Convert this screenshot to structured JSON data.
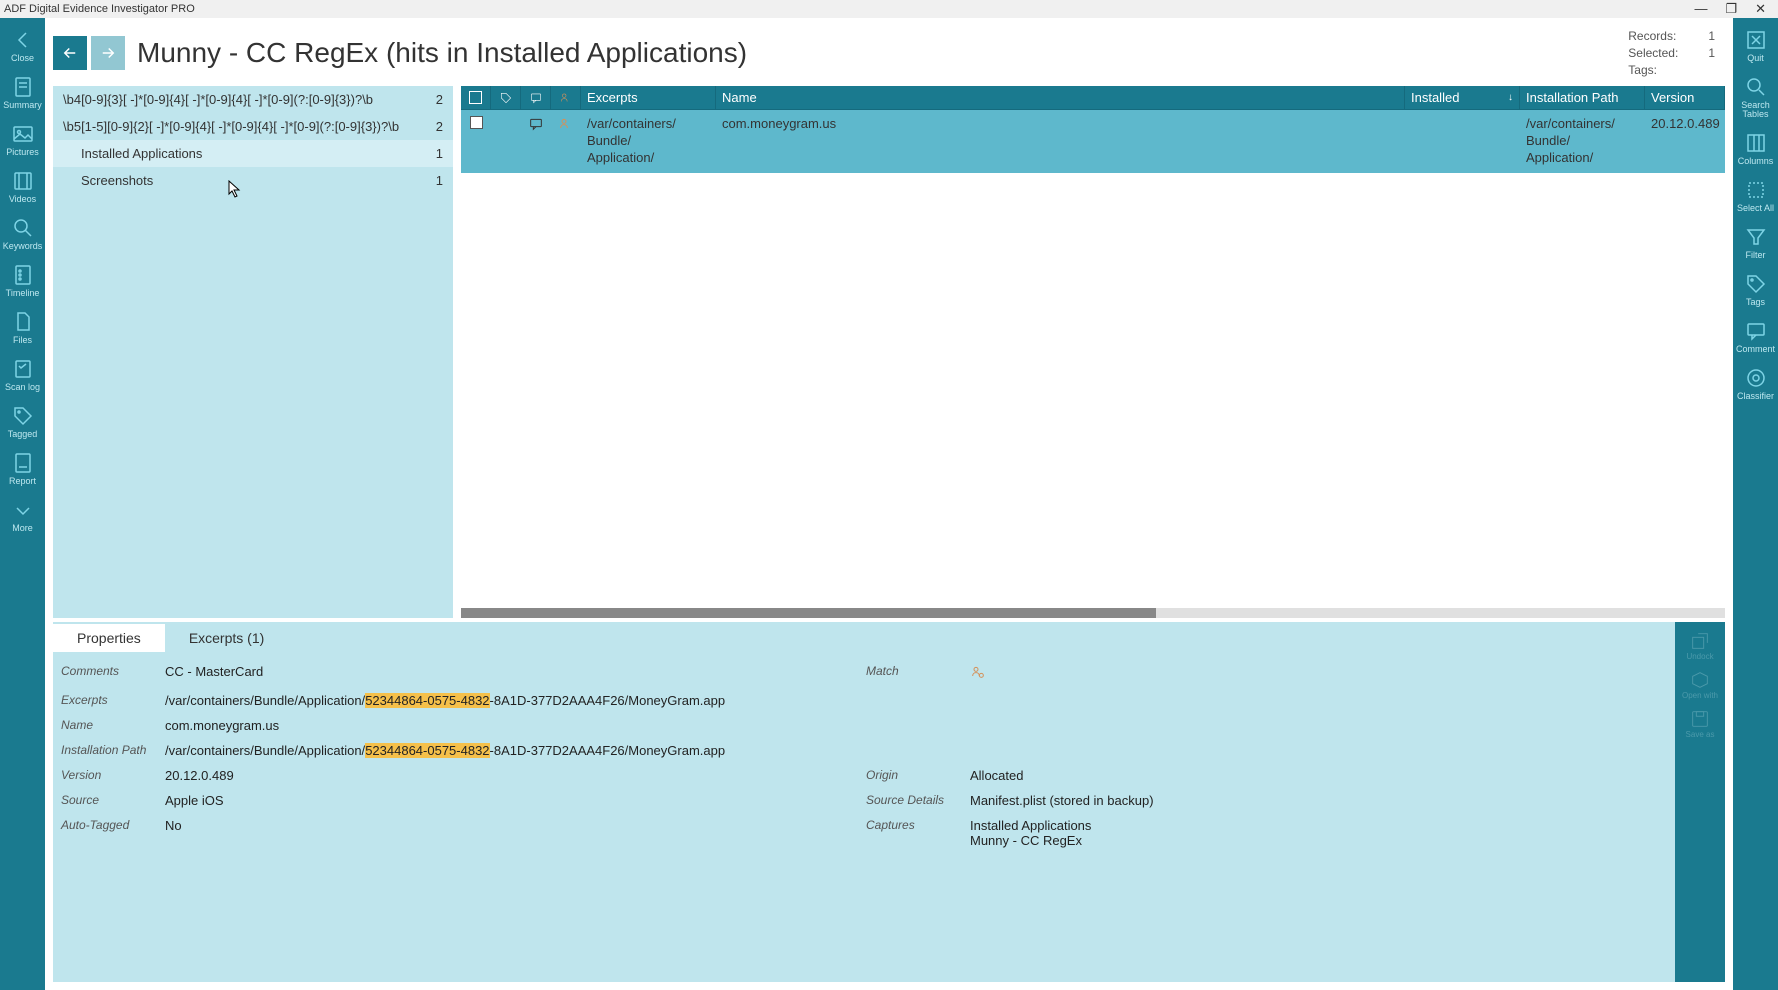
{
  "window": {
    "title": "ADF Digital Evidence Investigator PRO"
  },
  "header": {
    "title": "Munny - CC RegEx (hits in Installed Applications)",
    "stats": {
      "records_label": "Records:",
      "records_value": "1",
      "selected_label": "Selected:",
      "selected_value": "1",
      "tags_label": "Tags:",
      "tags_value": ""
    }
  },
  "left_sidebar": [
    {
      "label": "Close",
      "icon": "chevron-left"
    },
    {
      "label": "Summary",
      "icon": "document"
    },
    {
      "label": "Pictures",
      "icon": "picture"
    },
    {
      "label": "Videos",
      "icon": "film"
    },
    {
      "label": "Keywords",
      "icon": "keywords"
    },
    {
      "label": "Timeline",
      "icon": "timeline"
    },
    {
      "label": "Files",
      "icon": "files"
    },
    {
      "label": "Scan log",
      "icon": "scanlog"
    },
    {
      "label": "Tagged",
      "icon": "tag"
    },
    {
      "label": "Report",
      "icon": "report"
    },
    {
      "label": "More",
      "icon": "chevron-down"
    }
  ],
  "right_sidebar": [
    {
      "label": "Quit",
      "icon": "quit"
    },
    {
      "label": "Search Tables",
      "icon": "search"
    },
    {
      "label": "Columns",
      "icon": "columns"
    },
    {
      "label": "Select All",
      "icon": "selectall"
    },
    {
      "label": "Filter",
      "icon": "filter"
    },
    {
      "label": "Tags",
      "icon": "tags"
    },
    {
      "label": "Comment",
      "icon": "comment"
    },
    {
      "label": "Classifier",
      "icon": "classifier"
    }
  ],
  "tree": [
    {
      "label": "\\b4[0-9]{3}[ -]*[0-9]{4}[ -]*[0-9]{4}[ -]*[0-9](?:[0-9]{3})?\\b",
      "count": "2",
      "indent": 0
    },
    {
      "label": "\\b5[1-5][0-9]{2}[ -]*[0-9]{4}[ -]*[0-9]{4}[ -]*[0-9](?:[0-9]{3})?\\b",
      "count": "2",
      "indent": 0
    },
    {
      "label": "Installed Applications",
      "count": "1",
      "indent": 1,
      "hover": true
    },
    {
      "label": "Screenshots",
      "count": "1",
      "indent": 1
    }
  ],
  "table": {
    "columns": {
      "excerpts": "Excerpts",
      "name": "Name",
      "installed": "Installed",
      "installation_path": "Installation Path",
      "version": "Version"
    },
    "rows": [
      {
        "excerpts": "/var/containers/\nBundle/\nApplication/",
        "name": "com.moneygram.us",
        "installed": "",
        "installation_path": "/var/containers/\nBundle/\nApplication/",
        "version": "20.12.0.489"
      }
    ]
  },
  "tabs": {
    "properties": "Properties",
    "excerpts": "Excerpts (1)"
  },
  "properties": {
    "labels": {
      "comments": "Comments",
      "excerpts": "Excerpts",
      "name": "Name",
      "installation_path": "Installation Path",
      "version": "Version",
      "source": "Source",
      "auto_tagged": "Auto-Tagged",
      "match": "Match",
      "origin": "Origin",
      "source_details": "Source Details",
      "captures": "Captures"
    },
    "values": {
      "comments": "CC - MasterCard",
      "excerpts_pre": "/var/containers/Bundle/Application/",
      "excerpts_hl": "52344864-0575-4832",
      "excerpts_post": "-8A1D-377D2AAA4F26/MoneyGram.app",
      "name": "com.moneygram.us",
      "installation_path_pre": "/var/containers/Bundle/Application/",
      "installation_path_hl": "52344864-0575-4832",
      "installation_path_post": "-8A1D-377D2AAA4F26/MoneyGram.app",
      "version": "20.12.0.489",
      "source": "Apple iOS",
      "auto_tagged": "No",
      "origin": "Allocated",
      "source_details": "Manifest.plist (stored in backup)",
      "captures": "Installed Applications\nMunny - CC RegEx"
    }
  },
  "detail_actions": [
    {
      "label": "Undock"
    },
    {
      "label": "Open with"
    },
    {
      "label": "Save as"
    }
  ]
}
